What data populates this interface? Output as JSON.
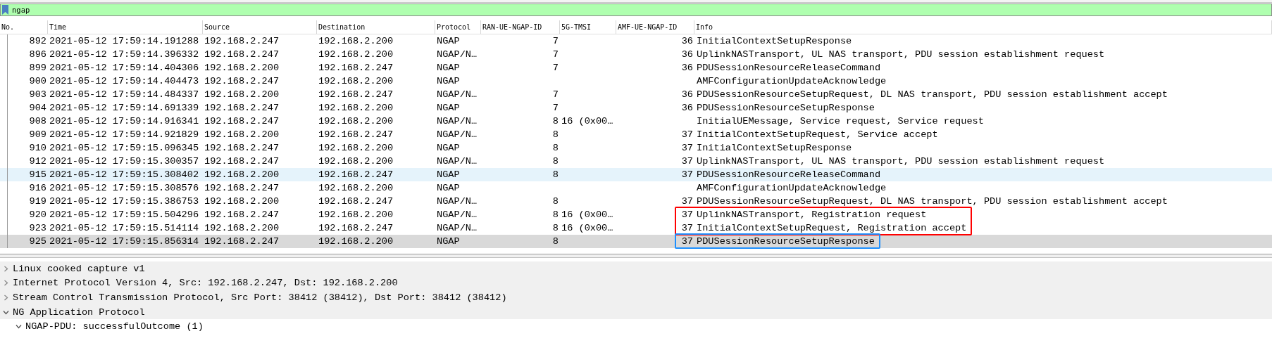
{
  "filter": {
    "value": "ngap"
  },
  "columns": [
    "No.",
    "Time",
    "Source",
    "Destination",
    "Protocol",
    "RAN-UE-NGAP-ID",
    "5G-TMSI",
    "AMF-UE-NGAP-ID",
    "Info"
  ],
  "packets": [
    {
      "no": "892",
      "time": "2021-05-12 17:59:14.191288",
      "source": "192.168.2.247",
      "destination": "192.168.2.200",
      "protocol": "NGAP",
      "ran_ue_ngap_id": "7",
      "amf_ue_ngap_id": "36",
      "info": "InitialContextSetupResponse",
      "selected": false,
      "highlighted": false
    },
    {
      "no": "896",
      "time": "2021-05-12 17:59:14.396332",
      "source": "192.168.2.247",
      "destination": "192.168.2.200",
      "protocol": "NGAP/N…",
      "ran_ue_ngap_id": "7",
      "amf_ue_ngap_id": "36",
      "info": "UplinkNASTransport, UL NAS transport, PDU session establishment request",
      "selected": false,
      "highlighted": false
    },
    {
      "no": "899",
      "time": "2021-05-12 17:59:14.404306",
      "source": "192.168.2.200",
      "destination": "192.168.2.247",
      "protocol": "NGAP",
      "ran_ue_ngap_id": "7",
      "amf_ue_ngap_id": "36",
      "info": "PDUSessionResourceReleaseCommand",
      "selected": false,
      "highlighted": false
    },
    {
      "no": "900",
      "time": "2021-05-12 17:59:14.404473",
      "source": "192.168.2.247",
      "destination": "192.168.2.200",
      "protocol": "NGAP",
      "info": "AMFConfigurationUpdateAcknowledge",
      "selected": false,
      "highlighted": false
    },
    {
      "no": "903",
      "time": "2021-05-12 17:59:14.484337",
      "source": "192.168.2.200",
      "destination": "192.168.2.247",
      "protocol": "NGAP/N…",
      "ran_ue_ngap_id": "7",
      "amf_ue_ngap_id": "36",
      "info": "PDUSessionResourceSetupRequest, DL NAS transport, PDU session establishment accept",
      "selected": false,
      "highlighted": false
    },
    {
      "no": "904",
      "time": "2021-05-12 17:59:14.691339",
      "source": "192.168.2.247",
      "destination": "192.168.2.200",
      "protocol": "NGAP",
      "ran_ue_ngap_id": "7",
      "amf_ue_ngap_id": "36",
      "info": "PDUSessionResourceSetupResponse",
      "selected": false,
      "highlighted": false
    },
    {
      "no": "908",
      "time": "2021-05-12 17:59:14.916341",
      "source": "192.168.2.247",
      "destination": "192.168.2.200",
      "protocol": "NGAP/N…",
      "ran_ue_ngap_id": "8",
      "tmsi": "16 (0x00…",
      "info": "InitialUEMessage, Service request, Service request",
      "selected": false,
      "highlighted": false
    },
    {
      "no": "909",
      "time": "2021-05-12 17:59:14.921829",
      "source": "192.168.2.200",
      "destination": "192.168.2.247",
      "protocol": "NGAP/N…",
      "ran_ue_ngap_id": "8",
      "amf_ue_ngap_id": "37",
      "info": "InitialContextSetupRequest, Service accept",
      "selected": false,
      "highlighted": false
    },
    {
      "no": "910",
      "time": "2021-05-12 17:59:15.096345",
      "source": "192.168.2.247",
      "destination": "192.168.2.200",
      "protocol": "NGAP",
      "ran_ue_ngap_id": "8",
      "amf_ue_ngap_id": "37",
      "info": "InitialContextSetupResponse",
      "selected": false,
      "highlighted": false
    },
    {
      "no": "912",
      "time": "2021-05-12 17:59:15.300357",
      "source": "192.168.2.247",
      "destination": "192.168.2.200",
      "protocol": "NGAP/N…",
      "ran_ue_ngap_id": "8",
      "amf_ue_ngap_id": "37",
      "info": "UplinkNASTransport, UL NAS transport, PDU session establishment request",
      "selected": false,
      "highlighted": false
    },
    {
      "no": "915",
      "time": "2021-05-12 17:59:15.308402",
      "source": "192.168.2.200",
      "destination": "192.168.2.247",
      "protocol": "NGAP",
      "ran_ue_ngap_id": "8",
      "amf_ue_ngap_id": "37",
      "info": "PDUSessionResourceReleaseCommand",
      "selected": false,
      "highlighted": true
    },
    {
      "no": "916",
      "time": "2021-05-12 17:59:15.308576",
      "source": "192.168.2.247",
      "destination": "192.168.2.200",
      "protocol": "NGAP",
      "info": "AMFConfigurationUpdateAcknowledge",
      "selected": false,
      "highlighted": false
    },
    {
      "no": "919",
      "time": "2021-05-12 17:59:15.386753",
      "source": "192.168.2.200",
      "destination": "192.168.2.247",
      "protocol": "NGAP/N…",
      "ran_ue_ngap_id": "8",
      "amf_ue_ngap_id": "37",
      "info": "PDUSessionResourceSetupRequest, DL NAS transport, PDU session establishment accept",
      "selected": false,
      "highlighted": false
    },
    {
      "no": "920",
      "time": "2021-05-12 17:59:15.504296",
      "source": "192.168.2.247",
      "destination": "192.168.2.200",
      "protocol": "NGAP/N…",
      "ran_ue_ngap_id": "8",
      "tmsi": "16 (0x00…",
      "amf_ue_ngap_id": "37",
      "info": "UplinkNASTransport, Registration request",
      "selected": false,
      "highlighted": false,
      "color": "#ff0000"
    },
    {
      "no": "923",
      "time": "2021-05-12 17:59:15.514114",
      "source": "192.168.2.200",
      "destination": "192.168.2.247",
      "protocol": "NGAP/N…",
      "ran_ue_ngap_id": "8",
      "tmsi": "16 (0x00…",
      "amf_ue_ngap_id": "37",
      "info": "InitialContextSetupRequest, Registration accept",
      "selected": false,
      "highlighted": false,
      "color": "#ff0000"
    },
    {
      "no": "925",
      "time": "2021-05-12 17:59:15.856314",
      "source": "192.168.2.247",
      "destination": "192.168.2.200",
      "protocol": "NGAP",
      "ran_ue_ngap_id": "8",
      "amf_ue_ngap_id": "37",
      "info": "PDUSessionResourceSetupResponse",
      "selected": true,
      "highlighted": false,
      "color": "#1e90ff"
    }
  ],
  "details": [
    {
      "label": "Linux cooked capture v1",
      "expanded": false
    },
    {
      "label": "Internet Protocol Version 4, Src: 192.168.2.247, Dst: 192.168.2.200",
      "expanded": false
    },
    {
      "label": "Stream Control Transmission Protocol, Src Port: 38412 (38412), Dst Port: 38412 (38412)",
      "expanded": false
    },
    {
      "label": "NG Application Protocol",
      "expanded": true,
      "children": [
        {
          "label": "NGAP-PDU: successfulOutcome (1)",
          "expanded": true
        }
      ]
    }
  ]
}
